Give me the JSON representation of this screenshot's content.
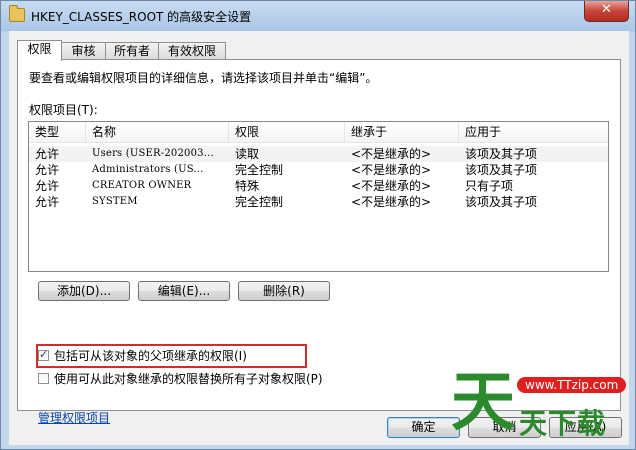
{
  "window": {
    "title": "HKEY_CLASSES_ROOT 的高级安全设置",
    "close_glyph": "✕"
  },
  "tabs": [
    {
      "label": "权限",
      "active": true
    },
    {
      "label": "审核",
      "active": false
    },
    {
      "label": "所有者",
      "active": false
    },
    {
      "label": "有效权限",
      "active": false
    }
  ],
  "panel": {
    "description": "要查看或编辑权限项目的详细信息，请选择该项目并单击“编辑”。",
    "list_label": "权限项目(T):",
    "columns": [
      "类型",
      "名称",
      "权限",
      "继承于",
      "应用于"
    ],
    "rows": [
      {
        "type": "允许",
        "name": "Users (USER-202003...",
        "permission": "读取",
        "inherited": "<不是继承的>",
        "applies": "该项及其子项",
        "selected": true
      },
      {
        "type": "允许",
        "name": "Administrators (US...",
        "permission": "完全控制",
        "inherited": "<不是继承的>",
        "applies": "该项及其子项",
        "selected": false
      },
      {
        "type": "允许",
        "name": "CREATOR OWNER",
        "permission": "特殊",
        "inherited": "<不是继承的>",
        "applies": "只有子项",
        "selected": false
      },
      {
        "type": "允许",
        "name": "SYSTEM",
        "permission": "完全控制",
        "inherited": "<不是继承的>",
        "applies": "该项及其子项",
        "selected": false
      }
    ],
    "buttons": {
      "add": "添加(D)...",
      "edit": "编辑(E)...",
      "remove": "删除(R)"
    },
    "include_inheritable": {
      "label": "包括可从该对象的父项继承的权限(I)",
      "checked": true
    },
    "replace_children": {
      "label": "使用可从此对象继承的权限替换所有子对象权限(P)",
      "checked": false
    },
    "manage_link": "管理权限项目"
  },
  "footer": {
    "ok": "确定",
    "cancel": "取消",
    "apply": "应用(A)"
  },
  "watermark": {
    "char": "天",
    "url": "www.TTzip.com",
    "text": "天下载"
  },
  "colors": {
    "highlight": "#d12b2b",
    "link": "#0645ad",
    "watermark_green": "#2b8a2b"
  }
}
